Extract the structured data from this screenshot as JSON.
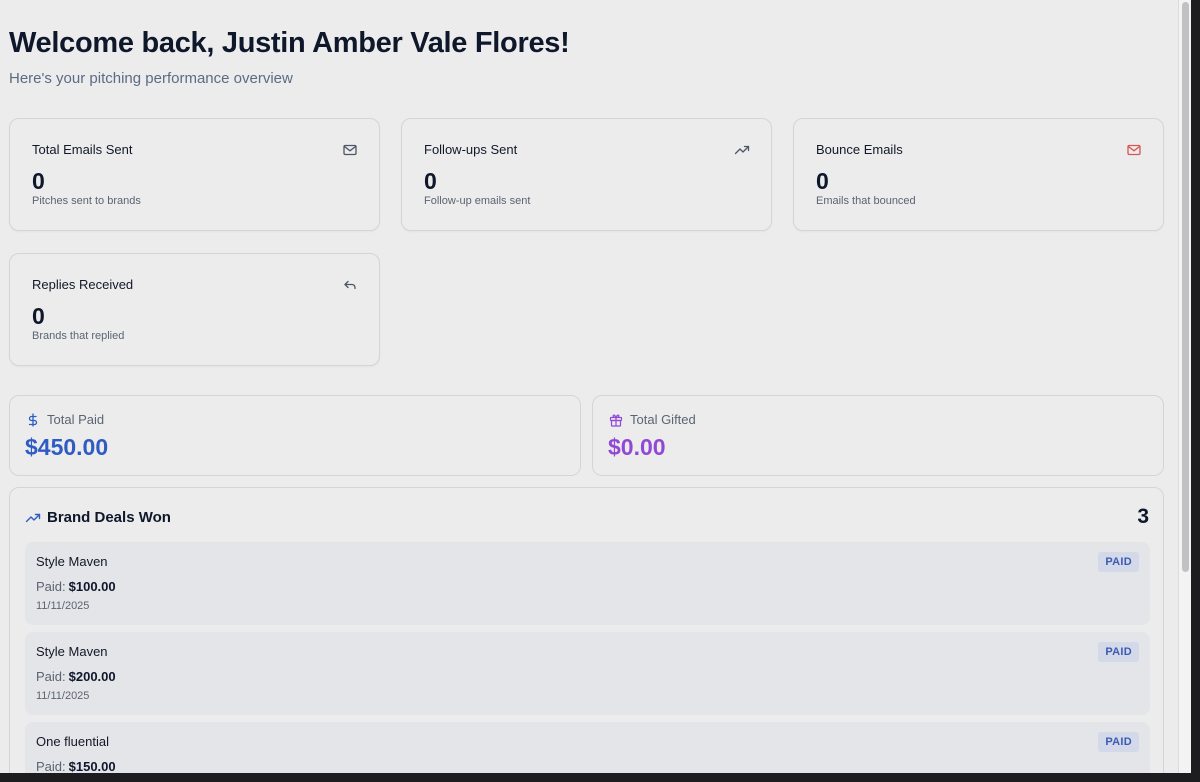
{
  "header": {
    "title": "Welcome back, Justin Amber Vale Flores!",
    "subtitle": "Here's your pitching performance overview"
  },
  "stats": [
    {
      "label": "Total Emails Sent",
      "value": "0",
      "desc": "Pitches sent to brands",
      "icon": "mail-icon"
    },
    {
      "label": "Follow-ups Sent",
      "value": "0",
      "desc": "Follow-up emails sent",
      "icon": "trending-up-icon"
    },
    {
      "label": "Bounce Emails",
      "value": "0",
      "desc": "Emails that bounced",
      "icon": "mail-icon"
    },
    {
      "label": "Replies Received",
      "value": "0",
      "desc": "Brands that replied",
      "icon": "reply-icon"
    }
  ],
  "money": {
    "paid": {
      "label": "Total Paid",
      "value": "$450.00",
      "icon": "dollar-icon",
      "color": "#2f5bc4"
    },
    "gifted": {
      "label": "Total Gifted",
      "value": "$0.00",
      "icon": "gift-icon",
      "color": "#9148d6"
    }
  },
  "deals": {
    "title": "Brand Deals Won",
    "count": "3",
    "paid_prefix": "Paid:",
    "items": [
      {
        "brand": "Style Maven",
        "amount": "$100.00",
        "date": "11/11/2025",
        "status": "PAID"
      },
      {
        "brand": "Style Maven",
        "amount": "$200.00",
        "date": "11/11/2025",
        "status": "PAID"
      },
      {
        "brand": "One fluential",
        "amount": "$150.00",
        "date": "",
        "status": "PAID"
      }
    ]
  },
  "colors": {
    "bounce_icon": "#d9534f",
    "accent_blue": "#2f5bc4",
    "accent_purple": "#9148d6"
  }
}
